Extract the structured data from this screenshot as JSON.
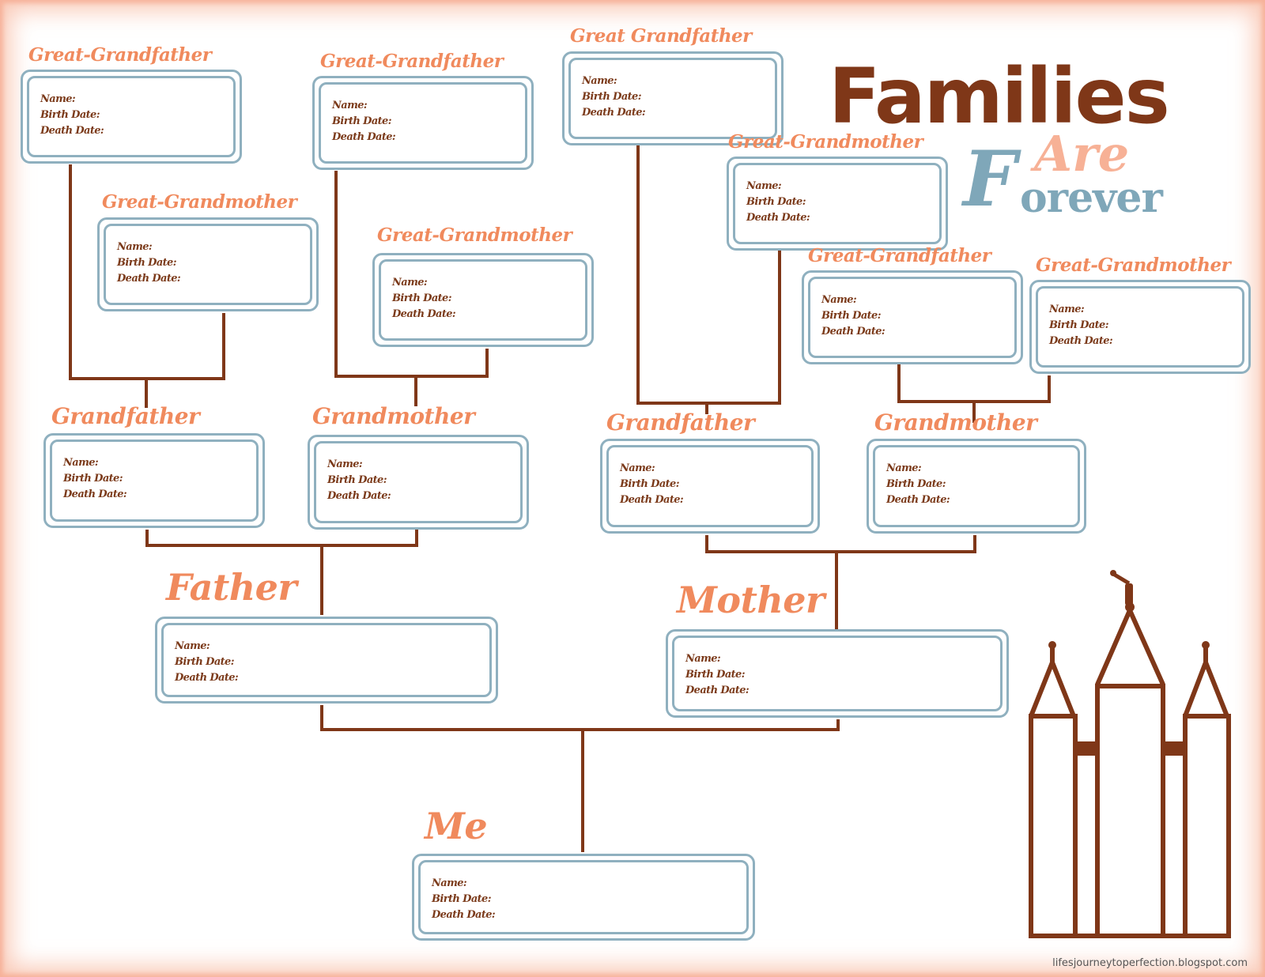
{
  "title": {
    "main": "Families",
    "letter_f": "F",
    "are": "Are",
    "orever": "orever",
    "full_subtitle": "Are Forever"
  },
  "field_labels": {
    "name": "Name:",
    "birth": "Birth Date:",
    "death": "Death Date:"
  },
  "people": {
    "ggf1": {
      "role": "Great-Grandfather"
    },
    "ggm1": {
      "role": "Great-Grandmother"
    },
    "ggf2": {
      "role": "Great-Grandfather"
    },
    "ggm2": {
      "role": "Great-Grandmother"
    },
    "ggf3": {
      "role": "Great Grandfather"
    },
    "ggm3": {
      "role": "Great-Grandmother"
    },
    "ggf4": {
      "role": "Great-Grandfather"
    },
    "ggm4": {
      "role": "Great-Grandmother"
    },
    "gf1": {
      "role": "Grandfather"
    },
    "gm1": {
      "role": "Grandmother"
    },
    "gf2": {
      "role": "Grandfather"
    },
    "gm2": {
      "role": "Grandmother"
    },
    "father": {
      "role": "Father"
    },
    "mother": {
      "role": "Mother"
    },
    "me": {
      "role": "Me"
    }
  },
  "credit": "lifesjourneytoperfection.blogspot.com",
  "colors": {
    "role_text": "#f08a5d",
    "field_text": "#7b3a1a",
    "box_border": "#8fb0bf",
    "connector": "#7f3718",
    "title_brown": "#7f3718",
    "title_blue": "#7fa7b9",
    "title_peach": "#f7a98b"
  }
}
